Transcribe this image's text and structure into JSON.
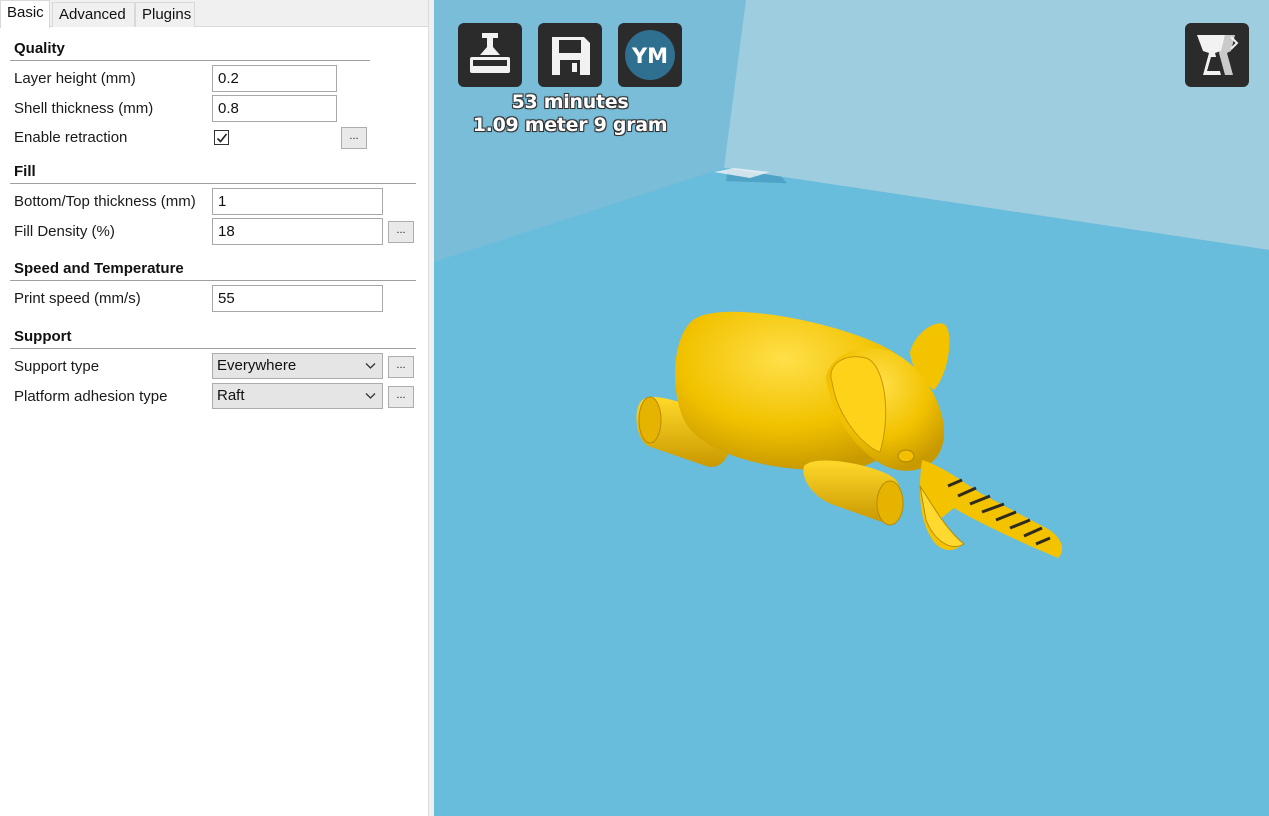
{
  "tabs": [
    {
      "label": "Basic",
      "active": true
    },
    {
      "label": "Advanced",
      "active": false
    },
    {
      "label": "Plugins",
      "active": false
    }
  ],
  "sections": {
    "quality": {
      "title": "Quality",
      "layer_height": {
        "label": "Layer height (mm)",
        "value": "0.2"
      },
      "shell_thickness": {
        "label": "Shell thickness (mm)",
        "value": "0.8"
      },
      "retraction": {
        "label": "Enable retraction",
        "checked": true,
        "button": "..."
      }
    },
    "fill": {
      "title": "Fill",
      "bottom_top_thickness": {
        "label": "Bottom/Top thickness (mm)",
        "value": "1"
      },
      "fill_density": {
        "label": "Fill Density (%)",
        "value": "18",
        "button": "..."
      }
    },
    "speed": {
      "title": "Speed and Temperature",
      "print_speed": {
        "label": "Print speed (mm/s)",
        "value": "55"
      }
    },
    "support": {
      "title": "Support",
      "support_type": {
        "label": "Support type",
        "value": "Everywhere",
        "button": "..."
      },
      "adhesion_type": {
        "label": "Platform adhesion type",
        "value": "Raft",
        "button": "..."
      }
    }
  },
  "viewport": {
    "toolbar": {
      "load_icon": "load-model-icon",
      "save_icon": "save-floppy-icon",
      "youmagine_label": "YM",
      "view_mode_icon": "view-mode-icon"
    },
    "print_time": "53 minutes",
    "print_material": "1.09 meter 9 gram",
    "colors": {
      "model": "#f2c500",
      "grid_light": "#68bcdc",
      "grid_dark": "#4ea3c6",
      "wall": "#8ec7dd",
      "toolbar_button": "#2b2b2b",
      "youmagine_circle": "#2f6f8f"
    }
  }
}
